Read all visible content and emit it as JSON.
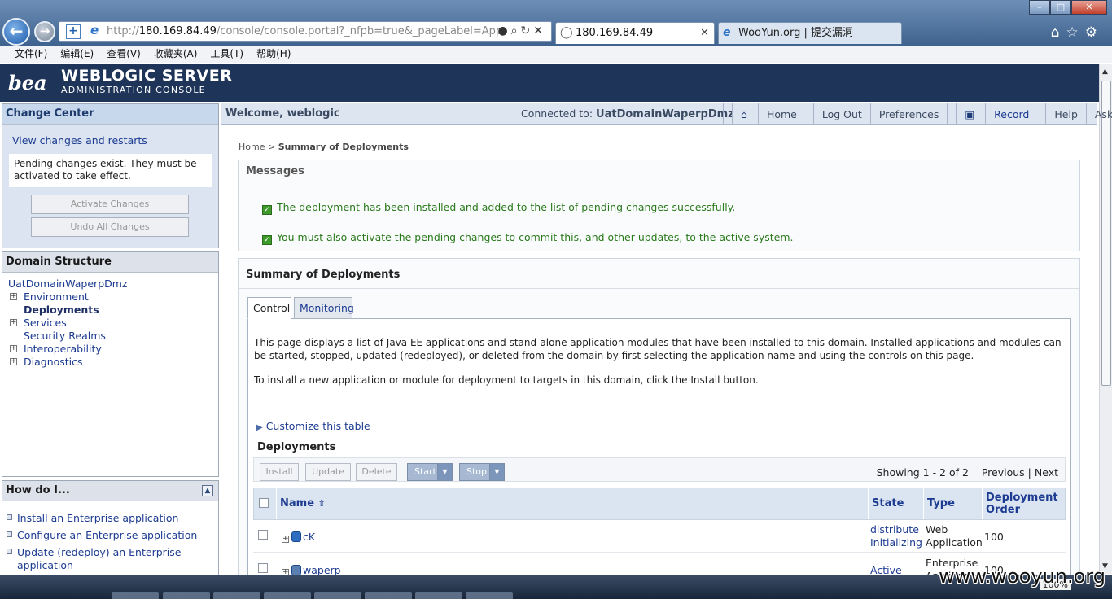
{
  "browser": {
    "url_prefix": "http://",
    "url_host": "180.169.84.49",
    "url_path": "/console/console.portal?_nfpb=true&_pageLabel=App",
    "tabs": [
      {
        "title": "180.169.84.49"
      },
      {
        "title": "WooYun.org | 提交漏洞"
      }
    ],
    "menu": [
      "文件(F)",
      "编辑(E)",
      "查看(V)",
      "收藏夹(A)",
      "工具(T)",
      "帮助(H)"
    ],
    "zoom": "100%"
  },
  "header": {
    "logo": "bea",
    "title": "WEBLOGIC SERVER",
    "subtitle": "ADMINISTRATION CONSOLE"
  },
  "change_center": {
    "title": "Change Center",
    "link": "View changes and restarts",
    "note": "Pending changes exist. They must be activated to take effect.",
    "activate_label": "Activate Changes",
    "undo_label": "Undo All Changes"
  },
  "domain_structure": {
    "title": "Domain Structure",
    "root": "UatDomainWaperpDmz",
    "items": [
      {
        "label": "Environment",
        "expandable": true
      },
      {
        "label": "Deployments",
        "expandable": false
      },
      {
        "label": "Services",
        "expandable": true
      },
      {
        "label": "Security Realms",
        "expandable": false
      },
      {
        "label": "Interoperability",
        "expandable": true
      },
      {
        "label": "Diagnostics",
        "expandable": true
      }
    ]
  },
  "how_do_i": {
    "title": "How do I...",
    "items": [
      "Install an Enterprise application",
      "Configure an Enterprise application",
      "Update (redeploy) an Enterprise application"
    ]
  },
  "topbar": {
    "welcome": "Welcome, weblogic",
    "connected_label": "Connected to:",
    "domain": "UatDomainWaperpDmz",
    "nav": [
      "Home",
      "Log Out",
      "Preferences",
      "Record",
      "Help",
      "AskBEA"
    ]
  },
  "breadcrumb": {
    "home": "Home",
    "separator": ">",
    "current": "Summary of Deployments"
  },
  "messages": {
    "title": "Messages",
    "items": [
      "The deployment has been installed and added to the list of pending changes successfully.",
      "You must also activate the pending changes to commit this, and other updates, to the active system."
    ]
  },
  "summary": {
    "title": "Summary of Deployments",
    "tabs": [
      "Control",
      "Monitoring"
    ],
    "desc1": "This page displays a list of Java EE applications and stand-alone application modules that have been installed to this domain. Installed applications and modules can be started, stopped, updated (redeployed), or deleted from the domain by first selecting the application name and using the controls on this page.",
    "desc2": "To install a new application or module for deployment to targets in this domain, click the Install button.",
    "customize": "Customize this table",
    "deployments_title": "Deployments",
    "buttons": {
      "install": "Install",
      "update": "Update",
      "delete": "Delete",
      "start": "Start",
      "stop": "Stop"
    },
    "paging": {
      "showing": "Showing 1 - 2 of 2",
      "previous": "Previous",
      "sep": "|",
      "next": "Next"
    },
    "columns": {
      "name": "Name",
      "state": "State",
      "type": "Type",
      "order": "Deployment Order"
    },
    "rows": [
      {
        "name": "cK",
        "state_line1": "distribute",
        "state_line2": "Initializing",
        "type": "Web Application",
        "order": "100"
      },
      {
        "name": "waperp",
        "state_line1": "Active",
        "state_line2": "",
        "type": "Enterprise Application",
        "order": "100"
      }
    ]
  },
  "watermark": "www.wooyun.org"
}
